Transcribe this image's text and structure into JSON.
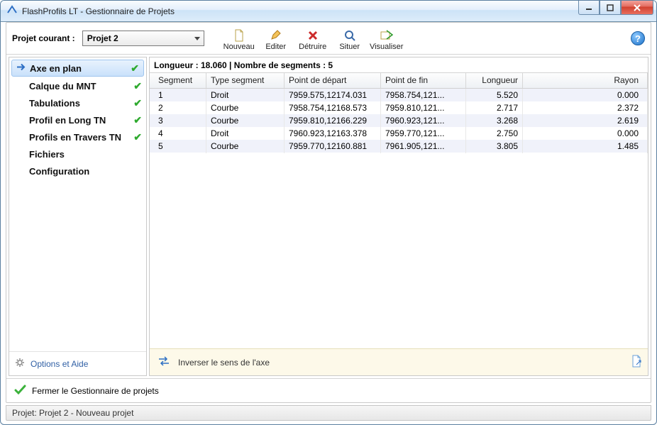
{
  "window": {
    "title": "FlashProfils LT - Gestionnaire de Projets"
  },
  "toolbar": {
    "current_project_label": "Projet courant :",
    "project_value": "Projet 2",
    "actions": {
      "nouveau": "Nouveau",
      "editer": "Editer",
      "detruire": "Détruire",
      "situer": "Situer",
      "visualiser": "Visualiser"
    }
  },
  "sidebar": {
    "items": [
      {
        "label": "Axe en plan",
        "checked": true,
        "selected": true
      },
      {
        "label": "Calque du MNT",
        "checked": true,
        "selected": false
      },
      {
        "label": "Tabulations",
        "checked": true,
        "selected": false
      },
      {
        "label": "Profil en Long TN",
        "checked": true,
        "selected": false
      },
      {
        "label": "Profils en Travers TN",
        "checked": true,
        "selected": false
      },
      {
        "label": "Fichiers",
        "checked": false,
        "selected": false
      },
      {
        "label": "Configuration",
        "checked": false,
        "selected": false
      }
    ],
    "footer_label": "Options et Aide"
  },
  "main": {
    "header": "Longueur : 18.060 | Nombre de segments : 5",
    "columns": {
      "segment": "Segment",
      "type": "Type segment",
      "start": "Point de départ",
      "end": "Point de fin",
      "length": "Longueur",
      "radius": "Rayon"
    },
    "rows": [
      {
        "segment": "1",
        "type": "Droit",
        "start": "7959.575,12174.031",
        "end": "7958.754,121...",
        "length": "5.520",
        "radius": "0.000"
      },
      {
        "segment": "2",
        "type": "Courbe",
        "start": "7958.754,12168.573",
        "end": "7959.810,121...",
        "length": "2.717",
        "radius": "2.372"
      },
      {
        "segment": "3",
        "type": "Courbe",
        "start": "7959.810,12166.229",
        "end": "7960.923,121...",
        "length": "3.268",
        "radius": "2.619"
      },
      {
        "segment": "4",
        "type": "Droit",
        "start": "7960.923,12163.378",
        "end": "7959.770,121...",
        "length": "2.750",
        "radius": "0.000"
      },
      {
        "segment": "5",
        "type": "Courbe",
        "start": "7959.770,12160.881",
        "end": "7961.905,121...",
        "length": "3.805",
        "radius": "1.485"
      }
    ],
    "footer_label": "Inverser le sens de l'axe"
  },
  "bottom": {
    "close_label": "Fermer le Gestionnaire de projets"
  },
  "status": {
    "text": "Projet: Projet 2 - Nouveau projet"
  }
}
